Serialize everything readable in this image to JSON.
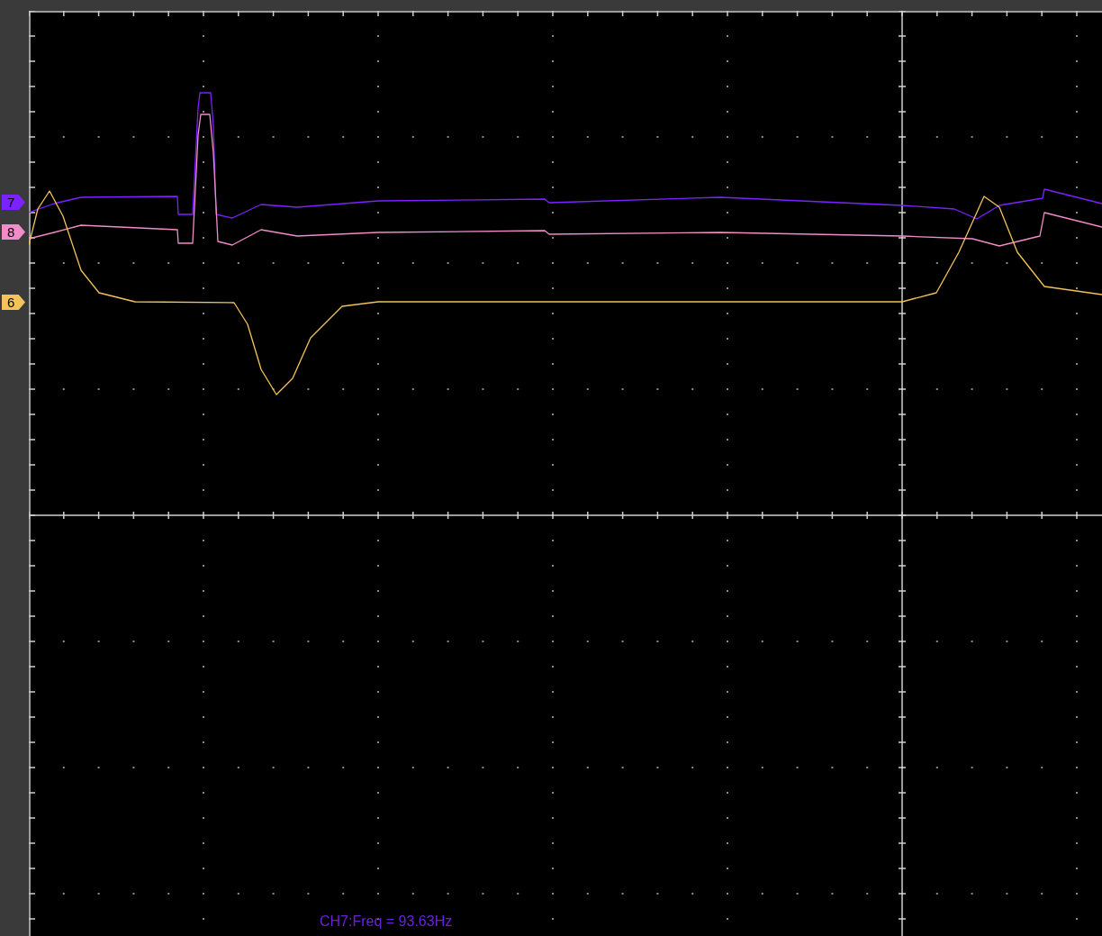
{
  "channels": [
    {
      "label": "7",
      "color": "#7b22ff"
    },
    {
      "label": "8",
      "color": "#f08cc8"
    },
    {
      "label": "6",
      "color": "#f2c45a"
    }
  ],
  "measurement": "CH7:Freq = 93.63Hz"
}
